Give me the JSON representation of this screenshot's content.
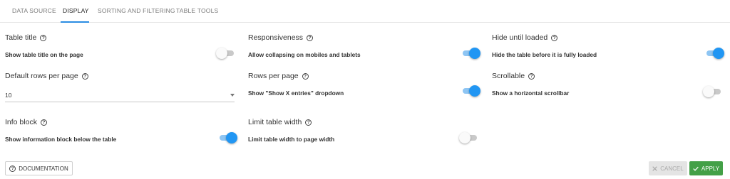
{
  "tabs": [
    {
      "label": "DATA SOURCE"
    },
    {
      "label": "DISPLAY"
    },
    {
      "label": "SORTING AND FILTERING"
    },
    {
      "label": "TABLE TOOLS"
    }
  ],
  "settings": {
    "table_title": {
      "label": "Table title",
      "desc": "Show table title on the page",
      "enabled": false
    },
    "responsiveness": {
      "label": "Responsiveness",
      "desc": "Allow collapsing on mobiles and tablets",
      "enabled": true
    },
    "hide_until_loaded": {
      "label": "Hide until loaded",
      "desc": "Hide the table before it is fully loaded",
      "enabled": true
    },
    "default_rows": {
      "label": "Default rows per page",
      "value": "10"
    },
    "rows_per_page": {
      "label": "Rows per page",
      "desc": "Show \"Show X entries\" dropdown",
      "enabled": true
    },
    "scrollable": {
      "label": "Scrollable",
      "desc": "Show a horizontal scrollbar",
      "enabled": false
    },
    "info_block": {
      "label": "Info block",
      "desc": "Show information block below the table",
      "enabled": true
    },
    "limit_width": {
      "label": "Limit table width",
      "desc": "Limit table width to page width",
      "enabled": false
    }
  },
  "help_glyph": "?",
  "footer": {
    "documentation_label": "DOCUMENTATION",
    "cancel_label": "CANCEL",
    "apply_label": "APPLY"
  },
  "colors": {
    "accent": "#2196f3",
    "apply": "#43a047"
  },
  "icons": {
    "help": "question-circle-icon",
    "cancel": "close-icon",
    "apply": "check-icon"
  }
}
